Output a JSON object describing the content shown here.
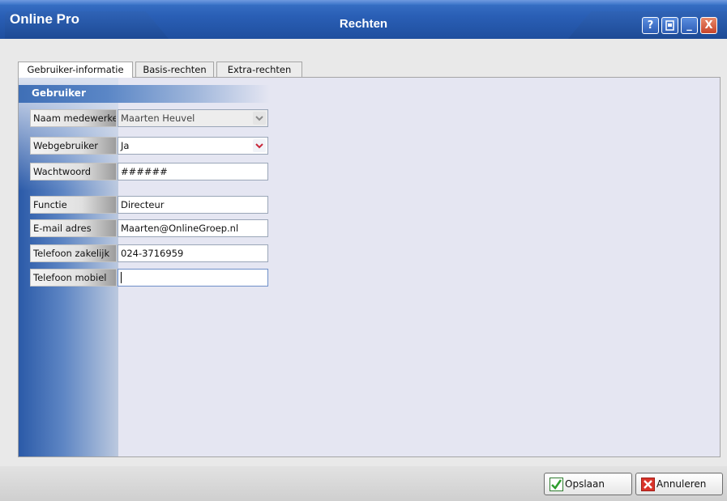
{
  "app": {
    "name": "Online Pro",
    "window_title": "Rechten"
  },
  "titlebar_buttons": {
    "help": "?",
    "minimize": "_",
    "close": "X"
  },
  "tabs": [
    {
      "label": "Gebruiker-informatie",
      "active": true
    },
    {
      "label": "Basis-rechten",
      "active": false
    },
    {
      "label": "Extra-rechten",
      "active": false
    }
  ],
  "section": {
    "title": "Gebruiker"
  },
  "form": {
    "naam": {
      "label": "Naam medewerke",
      "value": "Maarten Heuvel"
    },
    "webgebruiker": {
      "label": "Webgebruiker",
      "value": "Ja"
    },
    "wachtwoord": {
      "label": "Wachtwoord",
      "value": "######"
    },
    "functie": {
      "label": "Functie",
      "value": "Directeur"
    },
    "email": {
      "label": "E-mail adres",
      "value": "Maarten@OnlineGroep.nl"
    },
    "tel_zakelijk": {
      "label": "Telefoon zakelijk",
      "value": "024-3716959"
    },
    "tel_mobiel": {
      "label": "Telefoon mobiel",
      "value": ""
    }
  },
  "buttons": {
    "save": "Opslaan",
    "cancel": "Annuleren"
  },
  "colors": {
    "titlebar": "#2a5fb6",
    "panel": "#e5e6f2",
    "close": "#c8442a",
    "save_icon": "#2f9e2f",
    "cancel_icon": "#d9342b"
  }
}
